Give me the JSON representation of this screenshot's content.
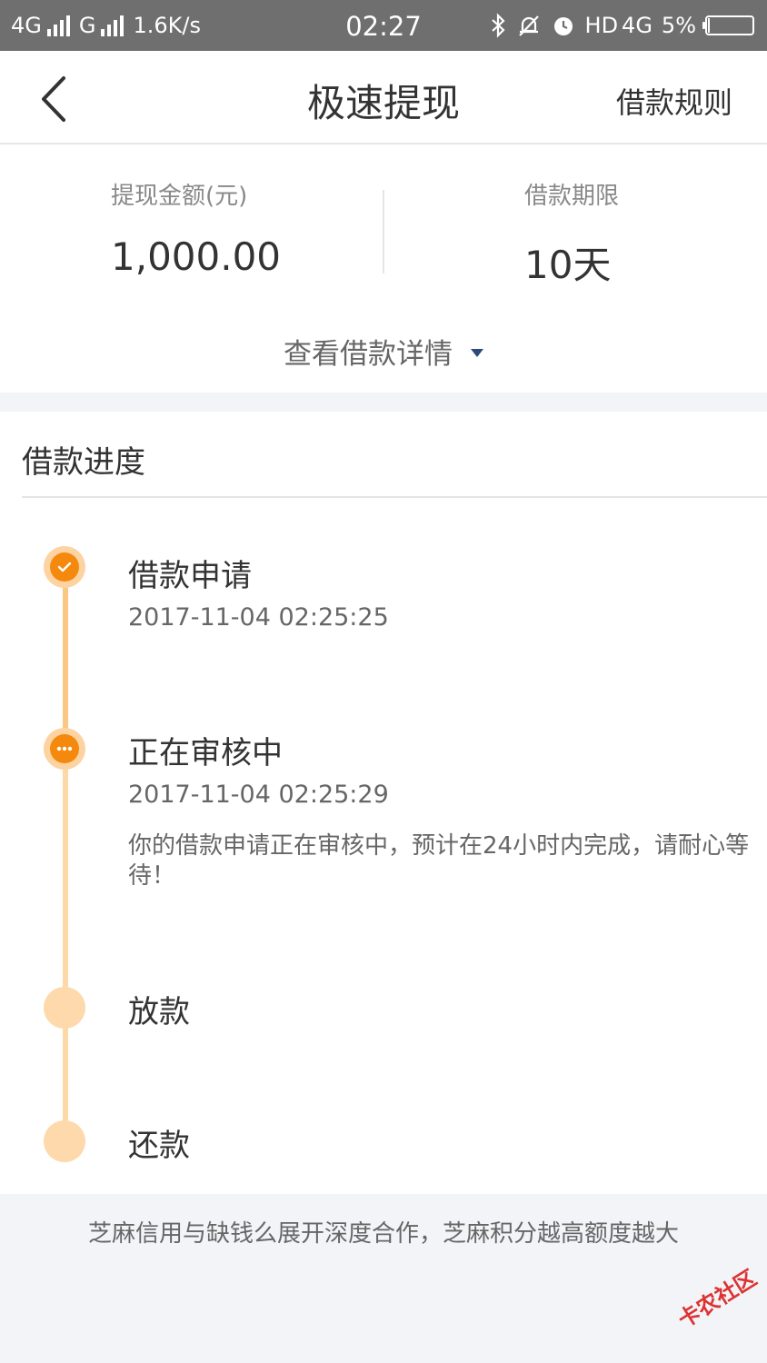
{
  "status_bar": {
    "network1": "4G",
    "network2": "G",
    "speed": "1.6K/s",
    "time": "02:27",
    "hd": "HD",
    "network3": "4G",
    "battery_text": "5%",
    "battery_level": 0.05,
    "icons": [
      "bluetooth-icon",
      "mute-bell-icon",
      "alarm-icon"
    ]
  },
  "navbar": {
    "title": "极速提现",
    "rules_link": "借款规则",
    "back_icon": "chevron-left-icon"
  },
  "summary": {
    "amount_label": "提现金额(元)",
    "amount_value": "1,000.00",
    "term_label": "借款期限",
    "term_value": "10天",
    "details_toggle": "查看借款详情"
  },
  "progress": {
    "title": "借款进度",
    "steps": [
      {
        "title": "借款申请",
        "time": "2017-11-04 02:25:25",
        "status": "done",
        "icon": "check-icon"
      },
      {
        "title": "正在审核中",
        "time": "2017-11-04 02:25:29",
        "desc": "你的借款申请正在审核中，预计在24小时内完成，请耐心等待！",
        "status": "in-progress",
        "icon": "ellipsis-icon"
      },
      {
        "title": "放款",
        "status": "pending"
      },
      {
        "title": "还款",
        "status": "pending"
      }
    ]
  },
  "footer_note": "芝麻信用与缺钱么展开深度合作，芝麻积分越高额度越大",
  "watermark": "卡农社区",
  "colors": {
    "accent": "#f4890e",
    "timeline_light": "#fdd9ac",
    "status_bar": "#6f6f6f"
  }
}
